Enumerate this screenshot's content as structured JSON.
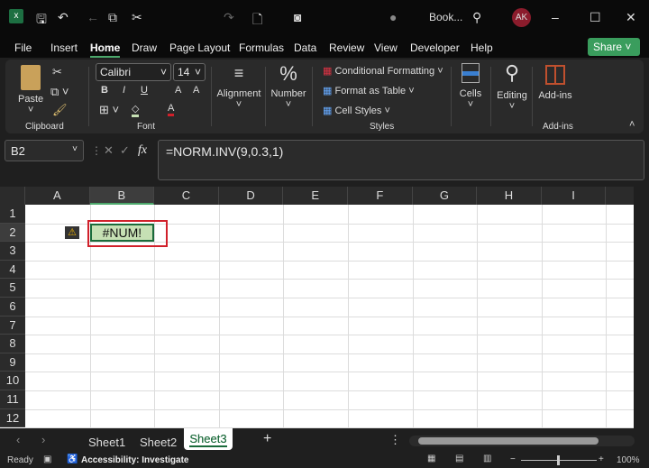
{
  "titlebar": {
    "doc_name": "Book...",
    "avatar": "AK"
  },
  "menu": {
    "tabs": [
      "File",
      "Insert",
      "Home",
      "Draw",
      "Page Layout",
      "Formulas",
      "Data",
      "Review",
      "View",
      "Developer",
      "Help"
    ],
    "active": "Home",
    "share": "Share"
  },
  "ribbon": {
    "clipboard": {
      "paste": "Paste",
      "label": "Clipboard"
    },
    "font": {
      "name": "Calibri",
      "size": "14",
      "bold": "B",
      "italic": "I",
      "underline": "U",
      "grow": "A",
      "shrink": "A",
      "color": "A",
      "label": "Font"
    },
    "alignment": "Alignment",
    "number": "Number",
    "styles": {
      "conditional": "Conditional Formatting",
      "table": "Format as Table",
      "cell_styles": "Cell Styles",
      "label": "Styles"
    },
    "cells": "Cells",
    "editing": "Editing",
    "addins": "Add-ins",
    "addins_label": "Add-ins"
  },
  "formula_bar": {
    "name_box": "B2",
    "fx": "fx",
    "formula": "=NORM.INV(9,0.3,1)"
  },
  "grid": {
    "columns": [
      "A",
      "B",
      "C",
      "D",
      "E",
      "F",
      "G",
      "H",
      "I"
    ],
    "rows": [
      "1",
      "2",
      "3",
      "4",
      "5",
      "6",
      "7",
      "8",
      "9",
      "10",
      "11",
      "12"
    ],
    "selected_cell": "B2",
    "cell_b2": "#NUM!"
  },
  "sheets": {
    "tabs": [
      "Sheet1",
      "Sheet2",
      "Sheet3"
    ],
    "active": "Sheet3"
  },
  "status": {
    "ready": "Ready",
    "accessibility": "Accessibility: Investigate",
    "zoom": "100%"
  },
  "colors": {
    "accent": "#4ca86b",
    "error_cell": "#c6e0b4",
    "highlight_box": "#d0202a"
  }
}
